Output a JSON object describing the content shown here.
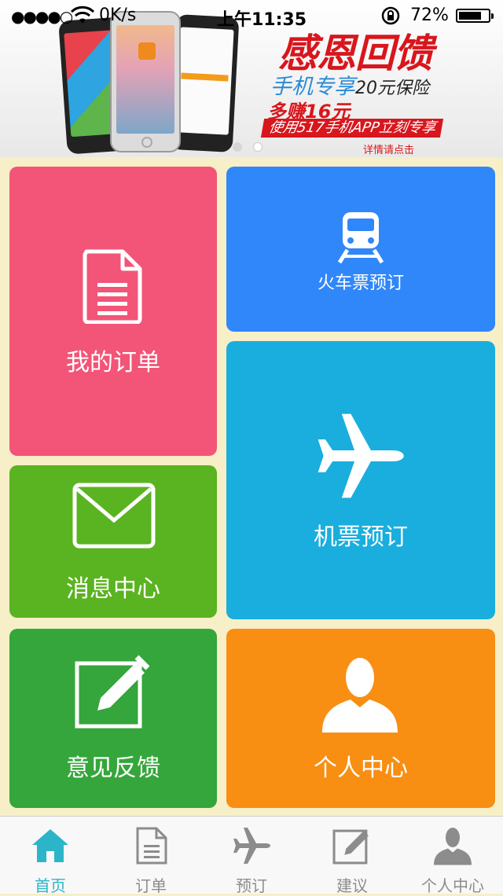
{
  "status_bar": {
    "signal": "●●●●○",
    "net_speed": "0K/s",
    "time": "上午11:35",
    "battery_pct": "72%"
  },
  "banner": {
    "title": "感恩回馈",
    "line1_main": "手机专享",
    "line1_small": "20元保险",
    "line2": "多赚16元",
    "line3": "使用517手机APP立刻专享",
    "link": "详情请点击",
    "pager": {
      "pages": 2,
      "active": 2
    }
  },
  "tiles": {
    "orders": {
      "label": "我的订单",
      "color": "#f25577",
      "icon": "document-icon"
    },
    "train": {
      "label": "火车票预订",
      "color": "#3087f9",
      "icon": "train-icon"
    },
    "messages": {
      "label": "消息中心",
      "color": "#5ab320",
      "icon": "envelope-icon"
    },
    "flight": {
      "label": "机票预订",
      "color": "#19aedd",
      "icon": "airplane-icon"
    },
    "feedback": {
      "label": "意见反馈",
      "color": "#34a63b",
      "icon": "edit-icon"
    },
    "profile": {
      "label": "个人中心",
      "color": "#f88e12",
      "icon": "person-icon"
    }
  },
  "tabbar": {
    "active_color": "#2cb5c9",
    "items": [
      {
        "label": "首页",
        "icon": "home-icon",
        "active": true
      },
      {
        "label": "订单",
        "icon": "document-icon",
        "active": false
      },
      {
        "label": "预订",
        "icon": "airplane-icon",
        "active": false
      },
      {
        "label": "建议",
        "icon": "edit-icon",
        "active": false
      },
      {
        "label": "个人中心",
        "icon": "person-icon",
        "active": false
      }
    ]
  }
}
